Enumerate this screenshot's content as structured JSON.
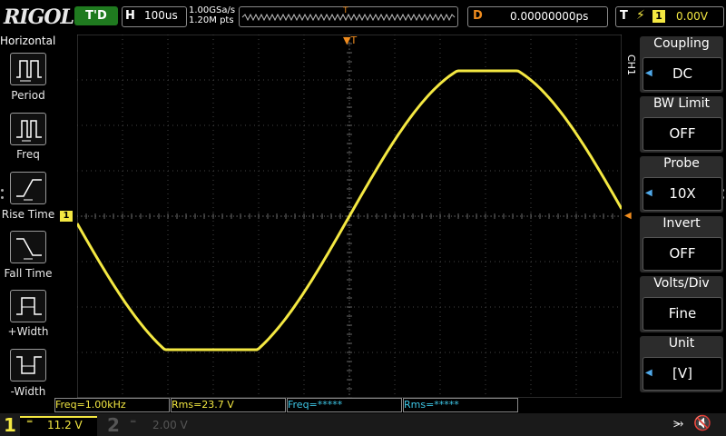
{
  "top_bar": {
    "logo": "RIGOL",
    "run_status": "T'D",
    "timebase_label": "H",
    "timebase_value": "100us",
    "sample_rate": "1.00GSa/s",
    "memory_depth": "1.20M pts",
    "trigger_position_marker": "T",
    "delay_label": "D",
    "delay_value": "0.00000000ps",
    "trigger_label": "T",
    "trigger_source": "1",
    "trigger_level": "0.00V"
  },
  "left_menu": {
    "title": "Horizontal",
    "items": [
      {
        "label": "Period",
        "icon": "period-icon"
      },
      {
        "label": "Freq",
        "icon": "freq-icon"
      },
      {
        "label": "Rise Time",
        "icon": "rise-time-icon"
      },
      {
        "label": "Fall Time",
        "icon": "fall-time-icon"
      },
      {
        "label": "+Width",
        "icon": "pos-width-icon"
      },
      {
        "label": "-Width",
        "icon": "neg-width-icon"
      }
    ]
  },
  "screen": {
    "ch1_marker": "1",
    "trigger_top_marker": "T"
  },
  "right_menu": {
    "channel_tab": "CH1",
    "items": [
      {
        "title": "Coupling",
        "value": "DC",
        "has_arrow": true
      },
      {
        "title": "BW Limit",
        "value": "OFF",
        "has_arrow": false
      },
      {
        "title": "Probe",
        "value": "10X",
        "has_arrow": true
      },
      {
        "title": "Invert",
        "value": "OFF",
        "has_arrow": false
      },
      {
        "title": "Volts/Div",
        "value": "Fine",
        "has_arrow": false
      },
      {
        "title": "Unit",
        "value": "[V]",
        "has_arrow": true
      }
    ]
  },
  "measurements": [
    {
      "text": "Freq=1.00kHz",
      "channel": 1
    },
    {
      "text": "Rms=23.7 V",
      "channel": 1
    },
    {
      "text": "Freq=*****",
      "channel": 2
    },
    {
      "text": "Rms=*****",
      "channel": 2
    }
  ],
  "bottom_bar": {
    "ch1_number": "1",
    "ch1_scale": "11.2 V",
    "ch2_number": "2",
    "ch2_scale": "2.00 V"
  },
  "colors": {
    "ch1": "#f4e842",
    "ch2": "#3ec8e8",
    "trigger": "#f08c1e",
    "run_status": "#1f7a1f"
  }
}
